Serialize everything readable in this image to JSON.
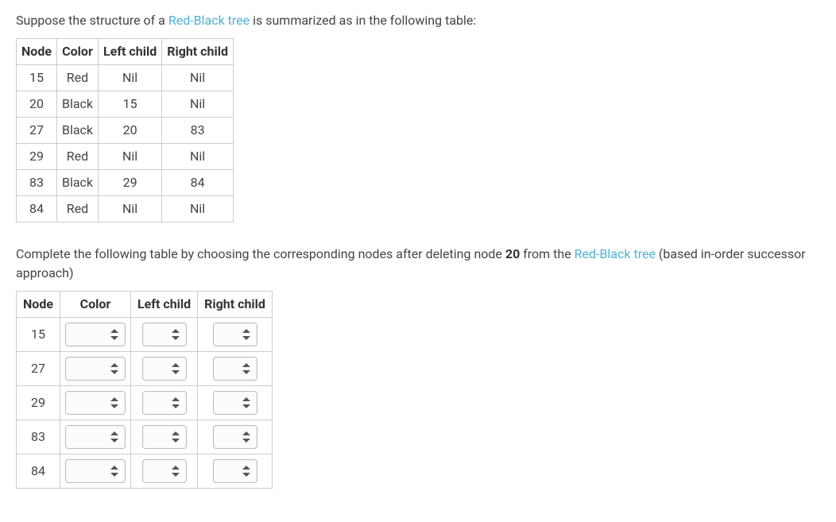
{
  "intro": {
    "prefix": "Suppose the structure of a ",
    "link1": "Red-Black tree",
    "suffix": " is summarized as in the following table:"
  },
  "headers": {
    "node": "Node",
    "color": "Color",
    "left": "Left child",
    "right": "Right child"
  },
  "tree": [
    {
      "node": "15",
      "color": "Red",
      "left": "Nil",
      "right": "Nil"
    },
    {
      "node": "20",
      "color": "Black",
      "left": "15",
      "right": "Nil"
    },
    {
      "node": "27",
      "color": "Black",
      "left": "20",
      "right": "83"
    },
    {
      "node": "29",
      "color": "Red",
      "left": "Nil",
      "right": "Nil"
    },
    {
      "node": "83",
      "color": "Black",
      "left": "29",
      "right": "84"
    },
    {
      "node": "84",
      "color": "Red",
      "left": "Nil",
      "right": "Nil"
    }
  ],
  "para2": {
    "prefix": "Complete the following table by choosing the corresponding nodes after deleting node ",
    "bold": "20",
    "mid": " from the ",
    "link": "Red-Black tree",
    "suffix": " (based in-order successor approach)"
  },
  "answer_nodes": [
    "15",
    "27",
    "29",
    "83",
    "84"
  ]
}
